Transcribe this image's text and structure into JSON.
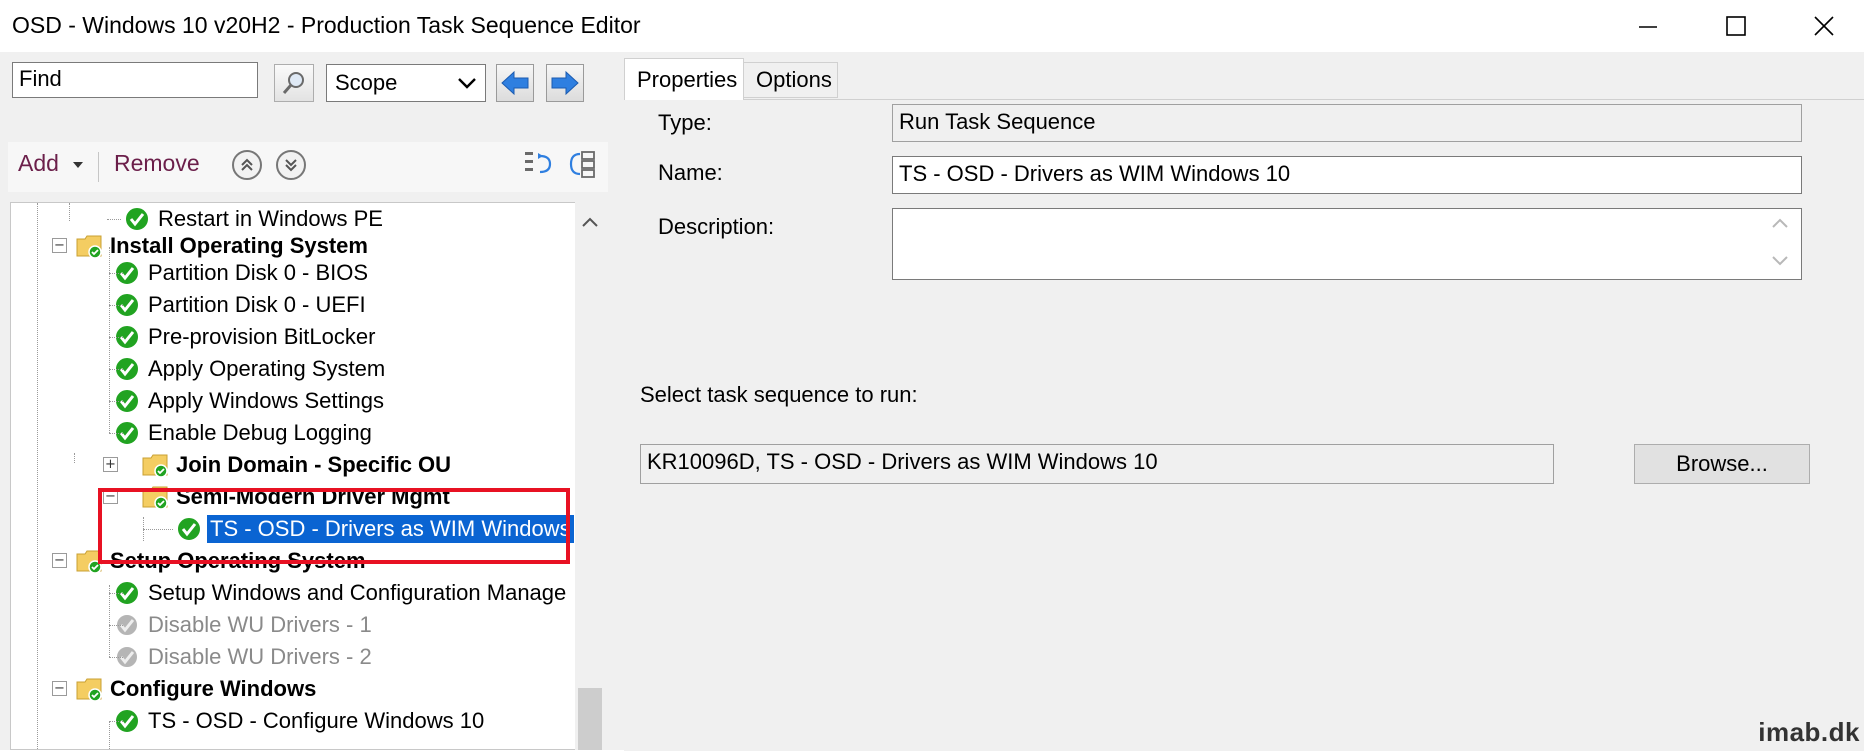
{
  "window": {
    "title": "OSD - Windows 10 v20H2 - Production Task Sequence Editor",
    "minimize_icon": "minimize-icon",
    "maximize_icon": "maximize-icon",
    "close_icon": "close-icon"
  },
  "search": {
    "value": "Find",
    "scope_value": "Scope"
  },
  "toolbar": {
    "add_label": "Add",
    "remove_label": "Remove"
  },
  "tree": {
    "items": [
      {
        "label": "Restart in Windows PE",
        "kind": "step",
        "state": "enabled"
      },
      {
        "label": "Install Operating System",
        "kind": "group",
        "expanded": true
      },
      {
        "label": "Partition Disk 0 - BIOS",
        "kind": "step",
        "state": "enabled"
      },
      {
        "label": "Partition Disk 0 - UEFI",
        "kind": "step",
        "state": "enabled"
      },
      {
        "label": "Pre-provision BitLocker",
        "kind": "step",
        "state": "enabled"
      },
      {
        "label": "Apply Operating System",
        "kind": "step",
        "state": "enabled"
      },
      {
        "label": "Apply Windows Settings",
        "kind": "step",
        "state": "enabled"
      },
      {
        "label": "Enable Debug Logging",
        "kind": "step",
        "state": "enabled"
      },
      {
        "label": "Join Domain - Specific OU",
        "kind": "group",
        "expanded": false
      },
      {
        "label": "Semi-Modern Driver Mgmt",
        "kind": "group",
        "expanded": true
      },
      {
        "label": "TS - OSD - Drivers as WIM Windows",
        "kind": "step",
        "state": "selected"
      },
      {
        "label": "Setup Operating System",
        "kind": "group",
        "expanded": true
      },
      {
        "label": "Setup Windows and Configuration Manage",
        "kind": "step",
        "state": "enabled"
      },
      {
        "label": "Disable WU Drivers - 1",
        "kind": "step",
        "state": "disabled"
      },
      {
        "label": "Disable WU Drivers - 2",
        "kind": "step",
        "state": "disabled"
      },
      {
        "label": "Configure Windows",
        "kind": "group",
        "expanded": true
      },
      {
        "label": "TS - OSD - Configure Windows 10",
        "kind": "step",
        "state": "enabled"
      }
    ]
  },
  "tabs": [
    {
      "label": "Properties",
      "active": true
    },
    {
      "label": "Options",
      "active": false
    }
  ],
  "properties": {
    "type_label": "Type:",
    "type_value": "Run Task Sequence",
    "name_label": "Name:",
    "name_value": "TS - OSD - Drivers as WIM Windows 10",
    "description_label": "Description:",
    "description_value": "",
    "select_ts_label": "Select task sequence to run:",
    "selected_ts_value": "KR10096D, TS - OSD - Drivers as WIM Windows 10",
    "browse_label": "Browse..."
  },
  "watermark": "imab.dk",
  "colors": {
    "selection": "#0a64d2",
    "highlight_box": "#e81123",
    "toolbar_text": "#6b1f4a",
    "check_green": "#21a321",
    "nav_arrow_blue": "#2f7fe0"
  }
}
